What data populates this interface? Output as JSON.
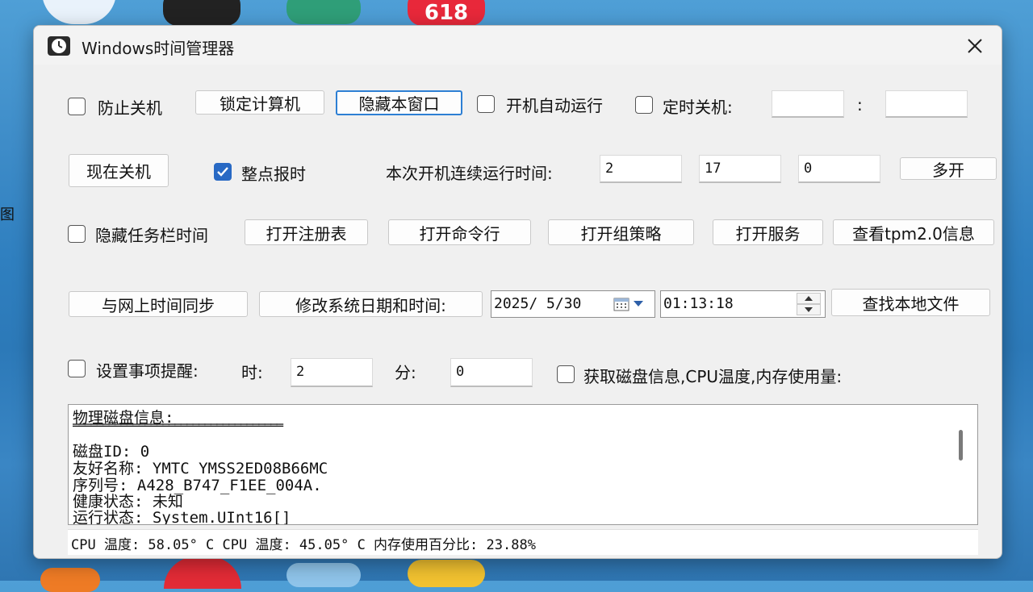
{
  "desktop": {
    "badge_618": "618",
    "left_edge_text": "图"
  },
  "window": {
    "title": "Windows时间管理器"
  },
  "row1": {
    "prevent_shutdown": "防止关机",
    "lock_computer": "锁定计算机",
    "hide_window": "隐藏本窗口",
    "autostart": "开机自动运行",
    "timed_shutdown": "定时关机:",
    "hour_value": "",
    "colon": ":",
    "minute_value": ""
  },
  "row2": {
    "shutdown_now": "现在关机",
    "hourly_chime": "整点报时",
    "runtime_label": "本次开机连续运行时间:",
    "runtime_h": "2",
    "runtime_m": "17",
    "runtime_s": "0",
    "multi_open": "多开"
  },
  "row3": {
    "hide_taskbar_time": "隐藏任务栏时间",
    "open_registry": "打开注册表",
    "open_cmd": "打开命令行",
    "open_gpedit": "打开组策略",
    "open_services": "打开服务",
    "view_tpm": "查看tpm2.0信息"
  },
  "row4": {
    "sync_time": "与网上时间同步",
    "modify_datetime": "修改系统日期和时间:",
    "date_value": "2025/ 5/30",
    "time_value": "01:13:18",
    "find_local_file": "查找本地文件"
  },
  "row5": {
    "set_reminder": "设置事项提醒:",
    "hour_label": "时:",
    "hour_value": "2",
    "minute_label": "分:",
    "minute_value": "0",
    "get_disk_info": "获取磁盘信息,CPU温度,内存使用量:"
  },
  "info_panel": {
    "lines": [
      "物理磁盘信息:",
      "═══════════════════════════════════",
      "",
      "磁盘ID: 0",
      "友好名称: YMTC YMSS2ED08B66MC",
      "序列号: A428_B747_F1EE_004A.",
      "健康状态: 未知",
      "运行状态: System.UInt16[]"
    ]
  },
  "status_bar": {
    "text": "CPU 温度: 58.05° C  CPU 温度: 45.05° C  内存使用百分比: 23.88%"
  },
  "colors": {
    "accent": "#2869c4",
    "focus_border": "#2d7fd4",
    "window_bg": "#f0f0f0"
  }
}
